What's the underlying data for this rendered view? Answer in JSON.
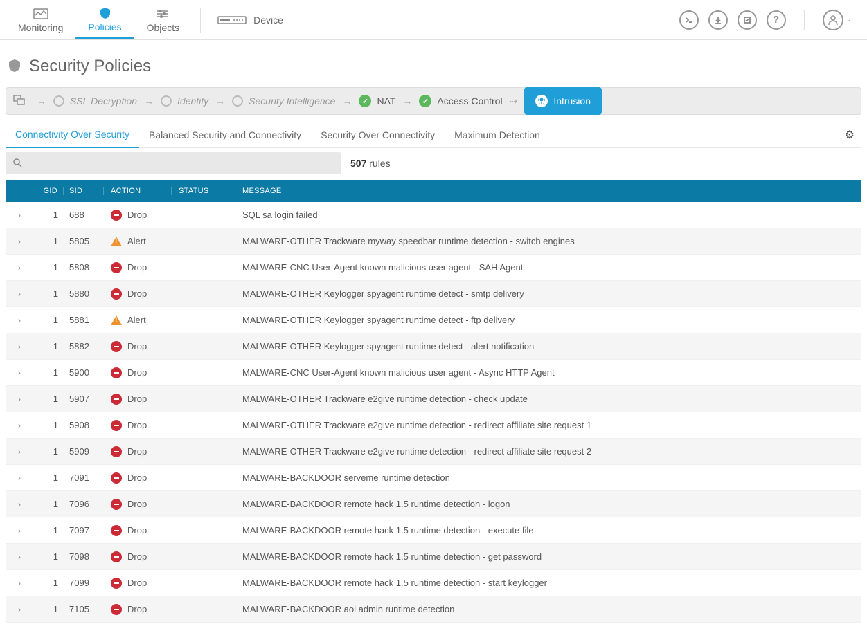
{
  "nav": {
    "monitoring": "Monitoring",
    "policies": "Policies",
    "objects": "Objects",
    "device": "Device"
  },
  "page": {
    "title": "Security Policies"
  },
  "flow": {
    "ssl": "SSL Decryption",
    "identity": "Identity",
    "si": "Security Intelligence",
    "nat": "NAT",
    "ac": "Access Control",
    "intrusion": "Intrusion"
  },
  "subtabs": {
    "cos": "Connectivity Over Security",
    "bsc": "Balanced Security and Connectivity",
    "soc": "Security Over Connectivity",
    "md": "Maximum Detection"
  },
  "search": {
    "placeholder": ""
  },
  "rules_count": "507",
  "rules_label": "rules",
  "table": {
    "headers": {
      "gid": "GID",
      "sid": "SID",
      "action": "ACTION",
      "status": "STATUS",
      "message": "MESSAGE"
    },
    "action_labels": {
      "drop": "Drop",
      "alert": "Alert"
    },
    "rows": [
      {
        "gid": "1",
        "sid": "688",
        "action": "drop",
        "message": "SQL sa login failed"
      },
      {
        "gid": "1",
        "sid": "5805",
        "action": "alert",
        "message": "MALWARE-OTHER Trackware myway speedbar runtime detection - switch engines"
      },
      {
        "gid": "1",
        "sid": "5808",
        "action": "drop",
        "message": "MALWARE-CNC User-Agent known malicious user agent - SAH Agent"
      },
      {
        "gid": "1",
        "sid": "5880",
        "action": "drop",
        "message": "MALWARE-OTHER Keylogger spyagent runtime detect - smtp delivery"
      },
      {
        "gid": "1",
        "sid": "5881",
        "action": "alert",
        "message": "MALWARE-OTHER Keylogger spyagent runtime detect - ftp delivery"
      },
      {
        "gid": "1",
        "sid": "5882",
        "action": "drop",
        "message": "MALWARE-OTHER Keylogger spyagent runtime detect - alert notification"
      },
      {
        "gid": "1",
        "sid": "5900",
        "action": "drop",
        "message": "MALWARE-CNC User-Agent known malicious user agent - Async HTTP Agent"
      },
      {
        "gid": "1",
        "sid": "5907",
        "action": "drop",
        "message": "MALWARE-OTHER Trackware e2give runtime detection - check update"
      },
      {
        "gid": "1",
        "sid": "5908",
        "action": "drop",
        "message": "MALWARE-OTHER Trackware e2give runtime detection - redirect affiliate site request 1"
      },
      {
        "gid": "1",
        "sid": "5909",
        "action": "drop",
        "message": "MALWARE-OTHER Trackware e2give runtime detection - redirect affiliate site request 2"
      },
      {
        "gid": "1",
        "sid": "7091",
        "action": "drop",
        "message": "MALWARE-BACKDOOR serveme runtime detection"
      },
      {
        "gid": "1",
        "sid": "7096",
        "action": "drop",
        "message": "MALWARE-BACKDOOR remote hack 1.5 runtime detection - logon"
      },
      {
        "gid": "1",
        "sid": "7097",
        "action": "drop",
        "message": "MALWARE-BACKDOOR remote hack 1.5 runtime detection - execute file"
      },
      {
        "gid": "1",
        "sid": "7098",
        "action": "drop",
        "message": "MALWARE-BACKDOOR remote hack 1.5 runtime detection - get password"
      },
      {
        "gid": "1",
        "sid": "7099",
        "action": "drop",
        "message": "MALWARE-BACKDOOR remote hack 1.5 runtime detection - start keylogger"
      },
      {
        "gid": "1",
        "sid": "7105",
        "action": "drop",
        "message": "MALWARE-BACKDOOR aol admin runtime detection"
      }
    ]
  }
}
